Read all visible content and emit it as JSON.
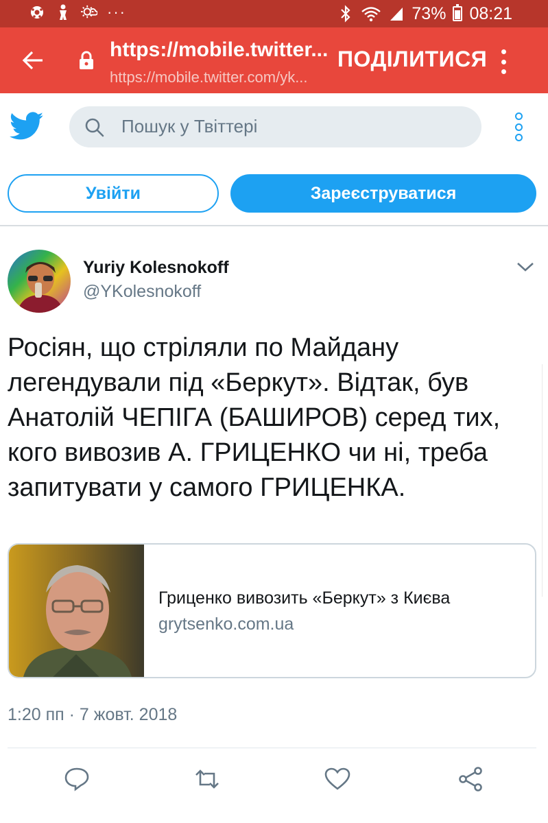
{
  "status_bar": {
    "battery": "73%",
    "time": "08:21",
    "overflow": "···"
  },
  "browser": {
    "url_title": "https://mobile.twitter...",
    "url_sub": "https://mobile.twitter.com/yk...",
    "share_label": "ПОДІЛИТИСЯ"
  },
  "twitter": {
    "search_placeholder": "Пошук у Твіттері",
    "login_label": "Увійти",
    "signup_label": "Зареєструватися"
  },
  "tweet": {
    "author_name": "Yuriy Kolesnokoff",
    "author_handle": "@YKolesnokoff",
    "text": "Росіян, що стріляли по Майдану легендували під «Беркут». Відтак, був Анатолій ЧЕПІГА (БАШИРОВ) серед тих, кого вивозив А. ГРИЦЕНКО чи ні, треба запитувати у самого ГРИЦЕНКА.",
    "card": {
      "title": "Гриценко вивозить «Беркут» з Києва",
      "domain": "grytsenko.com.ua"
    },
    "timestamp": "1:20 пп · 7 жовт. 2018"
  },
  "colors": {
    "status_bar": "#b7362b",
    "browser_bar": "#e8473c",
    "twitter_blue": "#1da1f2",
    "secondary_text": "#657786"
  },
  "icons": [
    "back-arrow-icon",
    "lock-icon",
    "menu-dots-icon",
    "twitter-bird-icon",
    "search-icon",
    "more-icon",
    "chevron-down-icon",
    "reply-icon",
    "retweet-icon",
    "like-icon",
    "share-icon"
  ]
}
